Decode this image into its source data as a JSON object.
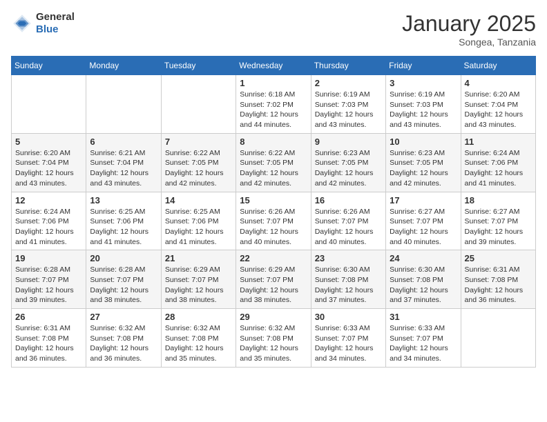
{
  "logo": {
    "general": "General",
    "blue": "Blue"
  },
  "title": "January 2025",
  "location": "Songea, Tanzania",
  "days_of_week": [
    "Sunday",
    "Monday",
    "Tuesday",
    "Wednesday",
    "Thursday",
    "Friday",
    "Saturday"
  ],
  "weeks": [
    [
      {
        "day": "",
        "info": ""
      },
      {
        "day": "",
        "info": ""
      },
      {
        "day": "",
        "info": ""
      },
      {
        "day": "1",
        "info": "Sunrise: 6:18 AM\nSunset: 7:02 PM\nDaylight: 12 hours\nand 44 minutes."
      },
      {
        "day": "2",
        "info": "Sunrise: 6:19 AM\nSunset: 7:03 PM\nDaylight: 12 hours\nand 43 minutes."
      },
      {
        "day": "3",
        "info": "Sunrise: 6:19 AM\nSunset: 7:03 PM\nDaylight: 12 hours\nand 43 minutes."
      },
      {
        "day": "4",
        "info": "Sunrise: 6:20 AM\nSunset: 7:04 PM\nDaylight: 12 hours\nand 43 minutes."
      }
    ],
    [
      {
        "day": "5",
        "info": "Sunrise: 6:20 AM\nSunset: 7:04 PM\nDaylight: 12 hours\nand 43 minutes."
      },
      {
        "day": "6",
        "info": "Sunrise: 6:21 AM\nSunset: 7:04 PM\nDaylight: 12 hours\nand 43 minutes."
      },
      {
        "day": "7",
        "info": "Sunrise: 6:22 AM\nSunset: 7:05 PM\nDaylight: 12 hours\nand 42 minutes."
      },
      {
        "day": "8",
        "info": "Sunrise: 6:22 AM\nSunset: 7:05 PM\nDaylight: 12 hours\nand 42 minutes."
      },
      {
        "day": "9",
        "info": "Sunrise: 6:23 AM\nSunset: 7:05 PM\nDaylight: 12 hours\nand 42 minutes."
      },
      {
        "day": "10",
        "info": "Sunrise: 6:23 AM\nSunset: 7:05 PM\nDaylight: 12 hours\nand 42 minutes."
      },
      {
        "day": "11",
        "info": "Sunrise: 6:24 AM\nSunset: 7:06 PM\nDaylight: 12 hours\nand 41 minutes."
      }
    ],
    [
      {
        "day": "12",
        "info": "Sunrise: 6:24 AM\nSunset: 7:06 PM\nDaylight: 12 hours\nand 41 minutes."
      },
      {
        "day": "13",
        "info": "Sunrise: 6:25 AM\nSunset: 7:06 PM\nDaylight: 12 hours\nand 41 minutes."
      },
      {
        "day": "14",
        "info": "Sunrise: 6:25 AM\nSunset: 7:06 PM\nDaylight: 12 hours\nand 41 minutes."
      },
      {
        "day": "15",
        "info": "Sunrise: 6:26 AM\nSunset: 7:07 PM\nDaylight: 12 hours\nand 40 minutes."
      },
      {
        "day": "16",
        "info": "Sunrise: 6:26 AM\nSunset: 7:07 PM\nDaylight: 12 hours\nand 40 minutes."
      },
      {
        "day": "17",
        "info": "Sunrise: 6:27 AM\nSunset: 7:07 PM\nDaylight: 12 hours\nand 40 minutes."
      },
      {
        "day": "18",
        "info": "Sunrise: 6:27 AM\nSunset: 7:07 PM\nDaylight: 12 hours\nand 39 minutes."
      }
    ],
    [
      {
        "day": "19",
        "info": "Sunrise: 6:28 AM\nSunset: 7:07 PM\nDaylight: 12 hours\nand 39 minutes."
      },
      {
        "day": "20",
        "info": "Sunrise: 6:28 AM\nSunset: 7:07 PM\nDaylight: 12 hours\nand 38 minutes."
      },
      {
        "day": "21",
        "info": "Sunrise: 6:29 AM\nSunset: 7:07 PM\nDaylight: 12 hours\nand 38 minutes."
      },
      {
        "day": "22",
        "info": "Sunrise: 6:29 AM\nSunset: 7:07 PM\nDaylight: 12 hours\nand 38 minutes."
      },
      {
        "day": "23",
        "info": "Sunrise: 6:30 AM\nSunset: 7:08 PM\nDaylight: 12 hours\nand 37 minutes."
      },
      {
        "day": "24",
        "info": "Sunrise: 6:30 AM\nSunset: 7:08 PM\nDaylight: 12 hours\nand 37 minutes."
      },
      {
        "day": "25",
        "info": "Sunrise: 6:31 AM\nSunset: 7:08 PM\nDaylight: 12 hours\nand 36 minutes."
      }
    ],
    [
      {
        "day": "26",
        "info": "Sunrise: 6:31 AM\nSunset: 7:08 PM\nDaylight: 12 hours\nand 36 minutes."
      },
      {
        "day": "27",
        "info": "Sunrise: 6:32 AM\nSunset: 7:08 PM\nDaylight: 12 hours\nand 36 minutes."
      },
      {
        "day": "28",
        "info": "Sunrise: 6:32 AM\nSunset: 7:08 PM\nDaylight: 12 hours\nand 35 minutes."
      },
      {
        "day": "29",
        "info": "Sunrise: 6:32 AM\nSunset: 7:08 PM\nDaylight: 12 hours\nand 35 minutes."
      },
      {
        "day": "30",
        "info": "Sunrise: 6:33 AM\nSunset: 7:07 PM\nDaylight: 12 hours\nand 34 minutes."
      },
      {
        "day": "31",
        "info": "Sunrise: 6:33 AM\nSunset: 7:07 PM\nDaylight: 12 hours\nand 34 minutes."
      },
      {
        "day": "",
        "info": ""
      }
    ]
  ]
}
